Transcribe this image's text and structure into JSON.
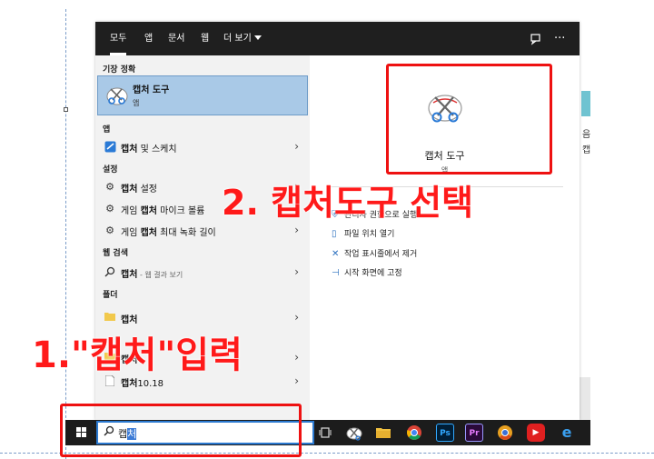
{
  "tabs": [
    {
      "label": "모두"
    },
    {
      "label": "앱"
    },
    {
      "label": "문서"
    },
    {
      "label": "웹"
    },
    {
      "label": "더 보기"
    }
  ],
  "toolbar_icons": [
    "feedback-icon",
    "more-options-icon"
  ],
  "left": {
    "best_match_heading": "기장 정확",
    "best_match": {
      "title": "캡처 도구",
      "subtitle": "앱"
    },
    "apps_heading": "앱",
    "apps": [
      {
        "bold": "캡처",
        "rest": " 및 스케치"
      }
    ],
    "settings_heading": "설정",
    "settings": [
      {
        "pre": "",
        "bold": "캡처",
        "rest": " 설정"
      },
      {
        "pre": "게임 ",
        "bold": "캡처",
        "rest": " 마이크 볼륨"
      },
      {
        "pre": "게임 ",
        "bold": "캡처",
        "rest": " 최대 녹화 길이"
      }
    ],
    "web_heading": "웹 검색",
    "web": {
      "bold": "캡처",
      "sub": " - 웹 결과 보기"
    },
    "folders_heading": "폴더",
    "folders": [
      {
        "bold": "캡처",
        "rest": ""
      },
      {
        "bold": "캡처",
        "rest": ""
      },
      {
        "bold": "캡처",
        "rest": "10.18"
      }
    ]
  },
  "right": {
    "app_title": "캡처 도구",
    "app_subtitle": "앱",
    "actions": [
      {
        "label": "관리자 권한으로 실행"
      },
      {
        "label": "파일 위치 열기"
      },
      {
        "label": "작업 표시줄에서 제거"
      },
      {
        "label": "시작 화면에 고정"
      }
    ]
  },
  "taskbar": {
    "search_value_plain": "캡",
    "search_value_selected": "처",
    "apps": [
      {
        "icon": "task-view-icon",
        "text": "",
        "color": "#1c1c1c"
      },
      {
        "icon": "snipping-tool-icon",
        "text": "",
        "color": "#1c1c1c"
      },
      {
        "icon": "file-explorer-icon",
        "text": "",
        "color": "#f0c040"
      },
      {
        "icon": "chrome-icon",
        "text": "",
        "color": "#1c1c1c"
      },
      {
        "icon": "photoshop-icon",
        "text": "Ps",
        "color": "#001e36"
      },
      {
        "icon": "premiere-icon",
        "text": "Pr",
        "color": "#2a0a3a"
      },
      {
        "icon": "chrome-alt-icon",
        "text": "",
        "color": "#1c1c1c"
      },
      {
        "icon": "youtube-icon",
        "text": "▶",
        "color": "#e02020"
      },
      {
        "icon": "edge-icon",
        "text": "e",
        "color": "#1c1c1c"
      }
    ]
  },
  "background": {
    "right_text_lines": [
      "음",
      "캡"
    ]
  },
  "annotations": {
    "step1": "1.\"캡처\"입력",
    "step2": "2. 캡처도구 선택",
    "color": "#ee1111"
  }
}
